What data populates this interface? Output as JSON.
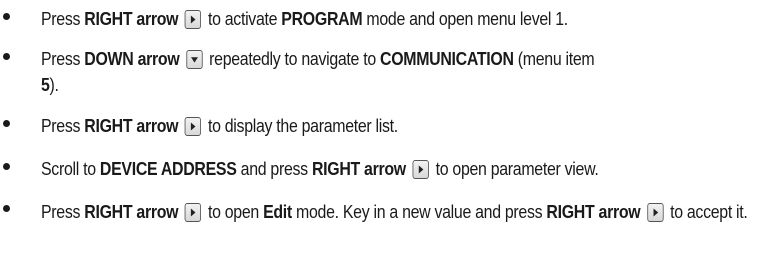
{
  "steps": [
    {
      "parts": [
        "Press ",
        "RIGHT arrow",
        " to activate ",
        "PROGRAM",
        " mode and open menu level 1."
      ]
    },
    {
      "parts": [
        "Press ",
        "DOWN arrow",
        " repeatedly to navigate to ",
        "COMMUNICATION",
        " (menu item ",
        "5",
        ")."
      ]
    },
    {
      "parts": [
        "Press ",
        "RIGHT arrow",
        " to display the parameter list."
      ]
    },
    {
      "parts": [
        "Scroll to ",
        "DEVICE ADDRESS",
        " and press ",
        "RIGHT arrow",
        " to open parameter view."
      ]
    },
    {
      "parts": [
        "Press ",
        "RIGHT arrow",
        " to open ",
        "Edit",
        " mode. Key in a new value and press ",
        "RIGHT arrow",
        " to accept it."
      ]
    }
  ],
  "icons": {
    "right_key": "right-arrow-key-icon",
    "down_key": "down-arrow-key-icon"
  }
}
